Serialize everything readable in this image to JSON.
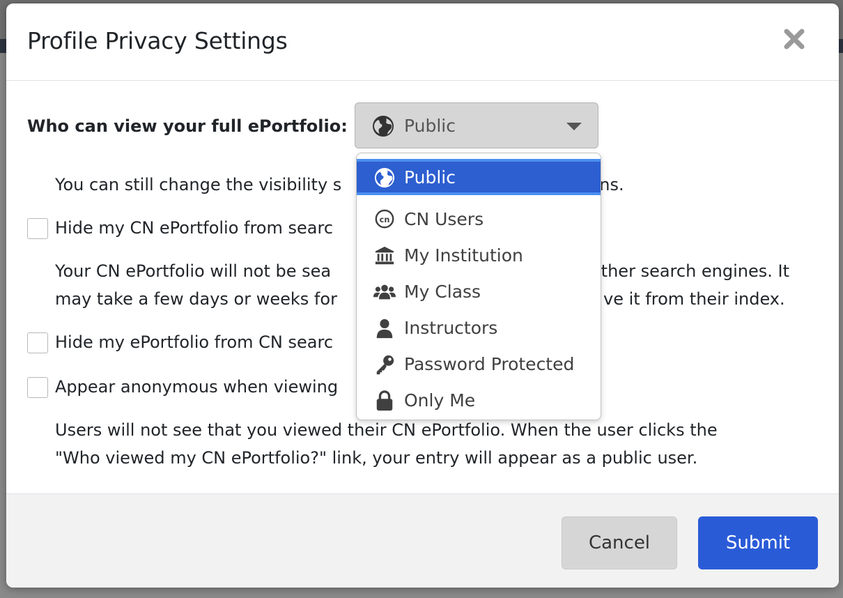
{
  "modal": {
    "title": "Profile Privacy Settings",
    "close_icon": "close-icon"
  },
  "visibility": {
    "label": "Who can view your full ePortfolio:",
    "selected_value": "Public",
    "selected_icon": "globe-icon",
    "help_text_visible": "You can still change the visibility s",
    "help_text_visible_end": "ns."
  },
  "dropdown": {
    "options": [
      {
        "label": "Public",
        "icon": "globe-icon",
        "selected": true
      },
      {
        "label": "CN Users",
        "icon": "cn-icon",
        "selected": false
      },
      {
        "label": "My Institution",
        "icon": "institution-icon",
        "selected": false
      },
      {
        "label": "My Class",
        "icon": "users-icon",
        "selected": false
      },
      {
        "label": "Instructors",
        "icon": "user-icon",
        "selected": false
      },
      {
        "label": "Password Protected",
        "icon": "key-icon",
        "selected": false
      },
      {
        "label": "Only Me",
        "icon": "lock-icon",
        "selected": false
      }
    ]
  },
  "options": {
    "hide_search": {
      "label_visible": "Hide my CN ePortfolio from searc",
      "checked": false,
      "desc_line1_start": "Your CN ePortfolio will not be sea",
      "desc_line1_end": "other search engines. It",
      "desc_line2_start": "may take a few days or weeks for",
      "desc_line2_end": "ve it from their index."
    },
    "hide_cn_search": {
      "label_visible": "Hide my ePortfolio from CN searc",
      "checked": false
    },
    "anonymous": {
      "label_visible": "Appear anonymous when viewing",
      "checked": false,
      "desc_line1": "Users will not see that you viewed their CN ePortfolio. When the user clicks the",
      "desc_line2": "\"Who viewed my CN ePortfolio?\" link, your entry will appear as a public user."
    }
  },
  "footer": {
    "cancel_label": "Cancel",
    "submit_label": "Submit"
  },
  "colors": {
    "primary": "#2a5bd7",
    "selected_item": "#2d5fd0",
    "select_bg": "#d6d6d6"
  }
}
